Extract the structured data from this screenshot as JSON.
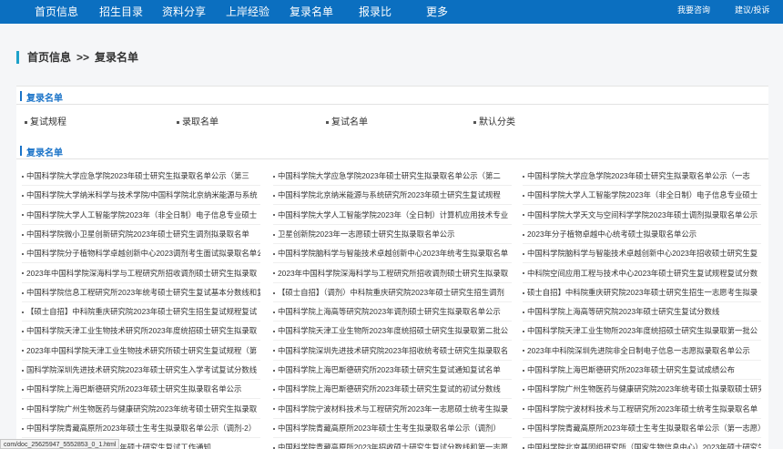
{
  "nav": {
    "items": [
      "首页信息",
      "招生目录",
      "资料分享",
      "上岸经验",
      "复录名单",
      "报录比",
      "更多"
    ],
    "consult": "我要咨询",
    "feedback": "建议/投诉"
  },
  "breadcrumb": {
    "home": "首页信息",
    "sep": ">>",
    "current": "复录名单"
  },
  "section1": {
    "title": "复录名单",
    "links": [
      "复试规程",
      "录取名单",
      "复试名单",
      "默认分类"
    ]
  },
  "section2": {
    "title": "复录名单",
    "items": [
      "中国科学院大学应急学院2023年硕士研究生拟录取名单公示（第三",
      "中国科学院大学应急学院2023年硕士研究生拟录取名单公示（第二",
      "中国科学院大学应急学院2023年硕士研究生拟录取名单公示（一志",
      "中国科学院大学纳米科学与技术学院/中国科学院北京纳米能源与系统",
      "中国科学院北京纳米能源与系统研究所2023年硕士研究生复试规程",
      "中国科学院大学人工智能学院2023年（非全日制）电子信息专业硕士",
      "中国科学院大学人工智能学院2023年（非全日制）电子信息专业硕士",
      "中国科学院大学人工智能学院2023年（全日制）计算机应用技术专业",
      "中国科学院大学天文与空间科学学院2023年硕士调剂拟录取名单公示",
      "中国科学院微小卫星创新研究院2023年硕士研究生调剂拟录取名单",
      "卫星创新院2023年一志愿硕士研究生拟录取名单公示",
      "2023年分子植物卓越中心统考硕士拟录取名单公示",
      "中国科学院分子植物科学卓越创新中心2023调剂考生面试拟录取名单公",
      "中国科学院脑科学与智能技术卓越创新中心2023年统考生拟录取名单",
      "中国科学院脑科学与智能技术卓越创新中心2023年招收硕士研究生复",
      "2023年中国科学院深海科学与工程研究所招收调剂硕士研究生拟录取",
      "2023年中国科学院深海科学与工程研究所招收调剂硕士研究生拟录取",
      "中科院空间应用工程与技术中心2023年硕士研究生复试规程复试分数",
      "中国科学院信息工程研究所2023年统考硕士研究生复试基本分数线和复试规",
      "【硕士自招】（调剂）中科院重庆研究院2023年硕士研究生招生调剂",
      "硕士自招】中科院重庆研究院2023年硕士研究生招生一志愿考生拟录",
      "【硕士自招】中科院重庆研究院2023年硕士研究生招生复试规程复试",
      "中国科学院上海高等研究院2023年调剂硕士研究生拟录取名单公示",
      "中国科学院上海高等研究院2023年硕士研究生复试分数线",
      "中国科学院天津工业生物技术研究所2023年度统招硕士研究生拟录取",
      "中国科学院天津工业生物所2023年度统招硕士研究生拟录取第二批公",
      "中国科学院天津工业生物所2023年度统招硕士研究生拟录取第一批公",
      "2023年中国科学院天津工业生物技术研究所硕士研究生复试规程（第",
      "中国科学院深圳先进技术研究院2023年招收统考硕士研究生拟录取名",
      "2023年中科院深圳先进院非全日制电子信息一志愿拟录取名单公示",
      "国科学院深圳先进技术研究院2023年硕士研究生入学考试复试分数线",
      "中国科学院上海巴斯德研究所2023年硕士研究生复试通知复试名单",
      "中国科学院上海巴斯德研究所2023年硕士研究生复试成绩公布",
      "中国科学院上海巴斯德研究所2023年硕士研究生拟录取名单公示",
      "中国科学院上海巴斯德研究所2023年硕士研究生复试的初试分数线",
      "中国科学院广州生物医药与健康研究院2023年统考硕士拟录取硕士研究生",
      "中国科学院广州生物医药与健康研究院2023年统考硕士研究生拟录取",
      "中国科学院宁波材料技术与工程研究所2023年一志愿硕士统考生拟录",
      "中国科学院宁波材料技术与工程研究所2023年硕士统考生拟录取名单",
      "中国科学院青藏高原所2023年硕士生考生拟录取名单公示（调剂-2）",
      "中国科学院青藏高原所2023年硕士生考生拟录取名单公示（调剂）",
      "中国科学院青藏高原所2023年硕士生考生拟录取名单公示（第一志愿）",
      "中国科学院青藏高原所2023年硕士研究生复试工作通知",
      "中国科学院青藏高原所2023年招收硕士研究生复试分数线和第一志愿",
      "中国科学院北京基因组研究所（国家生物信息中心）2023年硕士研究生复"
    ]
  },
  "status_bar": "com/doc_25625947_5552853_0_1.html"
}
